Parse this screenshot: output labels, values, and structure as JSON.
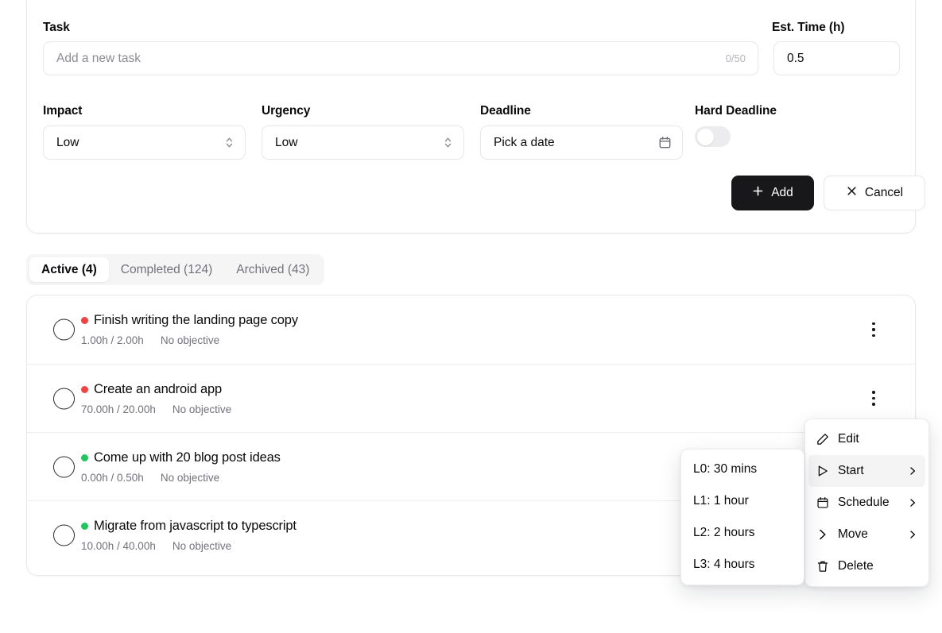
{
  "form": {
    "task_label": "Task",
    "task_placeholder": "Add a new task",
    "task_value": "",
    "task_counter": "0/50",
    "est_time_label": "Est. Time (h)",
    "est_time_value": "0.5",
    "impact_label": "Impact",
    "impact_value": "Low",
    "urgency_label": "Urgency",
    "urgency_value": "Low",
    "deadline_label": "Deadline",
    "deadline_value": "Pick a date",
    "hard_deadline_label": "Hard Deadline",
    "hard_deadline_on": false,
    "add_label": "Add",
    "cancel_label": "Cancel"
  },
  "tabs": [
    {
      "label": "Active (4)",
      "active": true
    },
    {
      "label": "Completed (124)",
      "active": false
    },
    {
      "label": "Archived (43)",
      "active": false
    }
  ],
  "tasks": [
    {
      "title": "Finish writing the landing page copy",
      "dot_color": "#ef4444",
      "time": "1.00h / 2.00h",
      "objective": "No objective"
    },
    {
      "title": "Create an android app",
      "dot_color": "#ef4444",
      "time": "70.00h / 20.00h",
      "objective": "No objective"
    },
    {
      "title": "Come up with 20 blog post ideas",
      "dot_color": "#22c55e",
      "time": "0.00h / 0.50h",
      "objective": "No objective"
    },
    {
      "title": "Migrate from javascript to typescript",
      "dot_color": "#22c55e",
      "time": "10.00h / 40.00h",
      "objective": "No objective"
    }
  ],
  "context_menu": [
    {
      "label": "Edit",
      "icon": "pencil-icon",
      "submenu": false,
      "highlight": false
    },
    {
      "label": "Start",
      "icon": "play-icon",
      "submenu": true,
      "highlight": true
    },
    {
      "label": "Schedule",
      "icon": "calendar-icon",
      "submenu": true,
      "highlight": false
    },
    {
      "label": "Move",
      "icon": "chevron-right-icon",
      "submenu": true,
      "highlight": false
    },
    {
      "label": "Delete",
      "icon": "trash-icon",
      "submenu": false,
      "highlight": false
    }
  ],
  "submenu": {
    "items": [
      {
        "label": "L0: 30 mins"
      },
      {
        "label": "L1: 1 hour"
      },
      {
        "label": "L2: 2 hours"
      },
      {
        "label": "L3: 4 hours"
      }
    ]
  },
  "colors": {
    "primary": "#18181b",
    "muted": "#71717a",
    "border": "#e8e8ea",
    "red": "#ef4444",
    "green": "#22c55e"
  }
}
